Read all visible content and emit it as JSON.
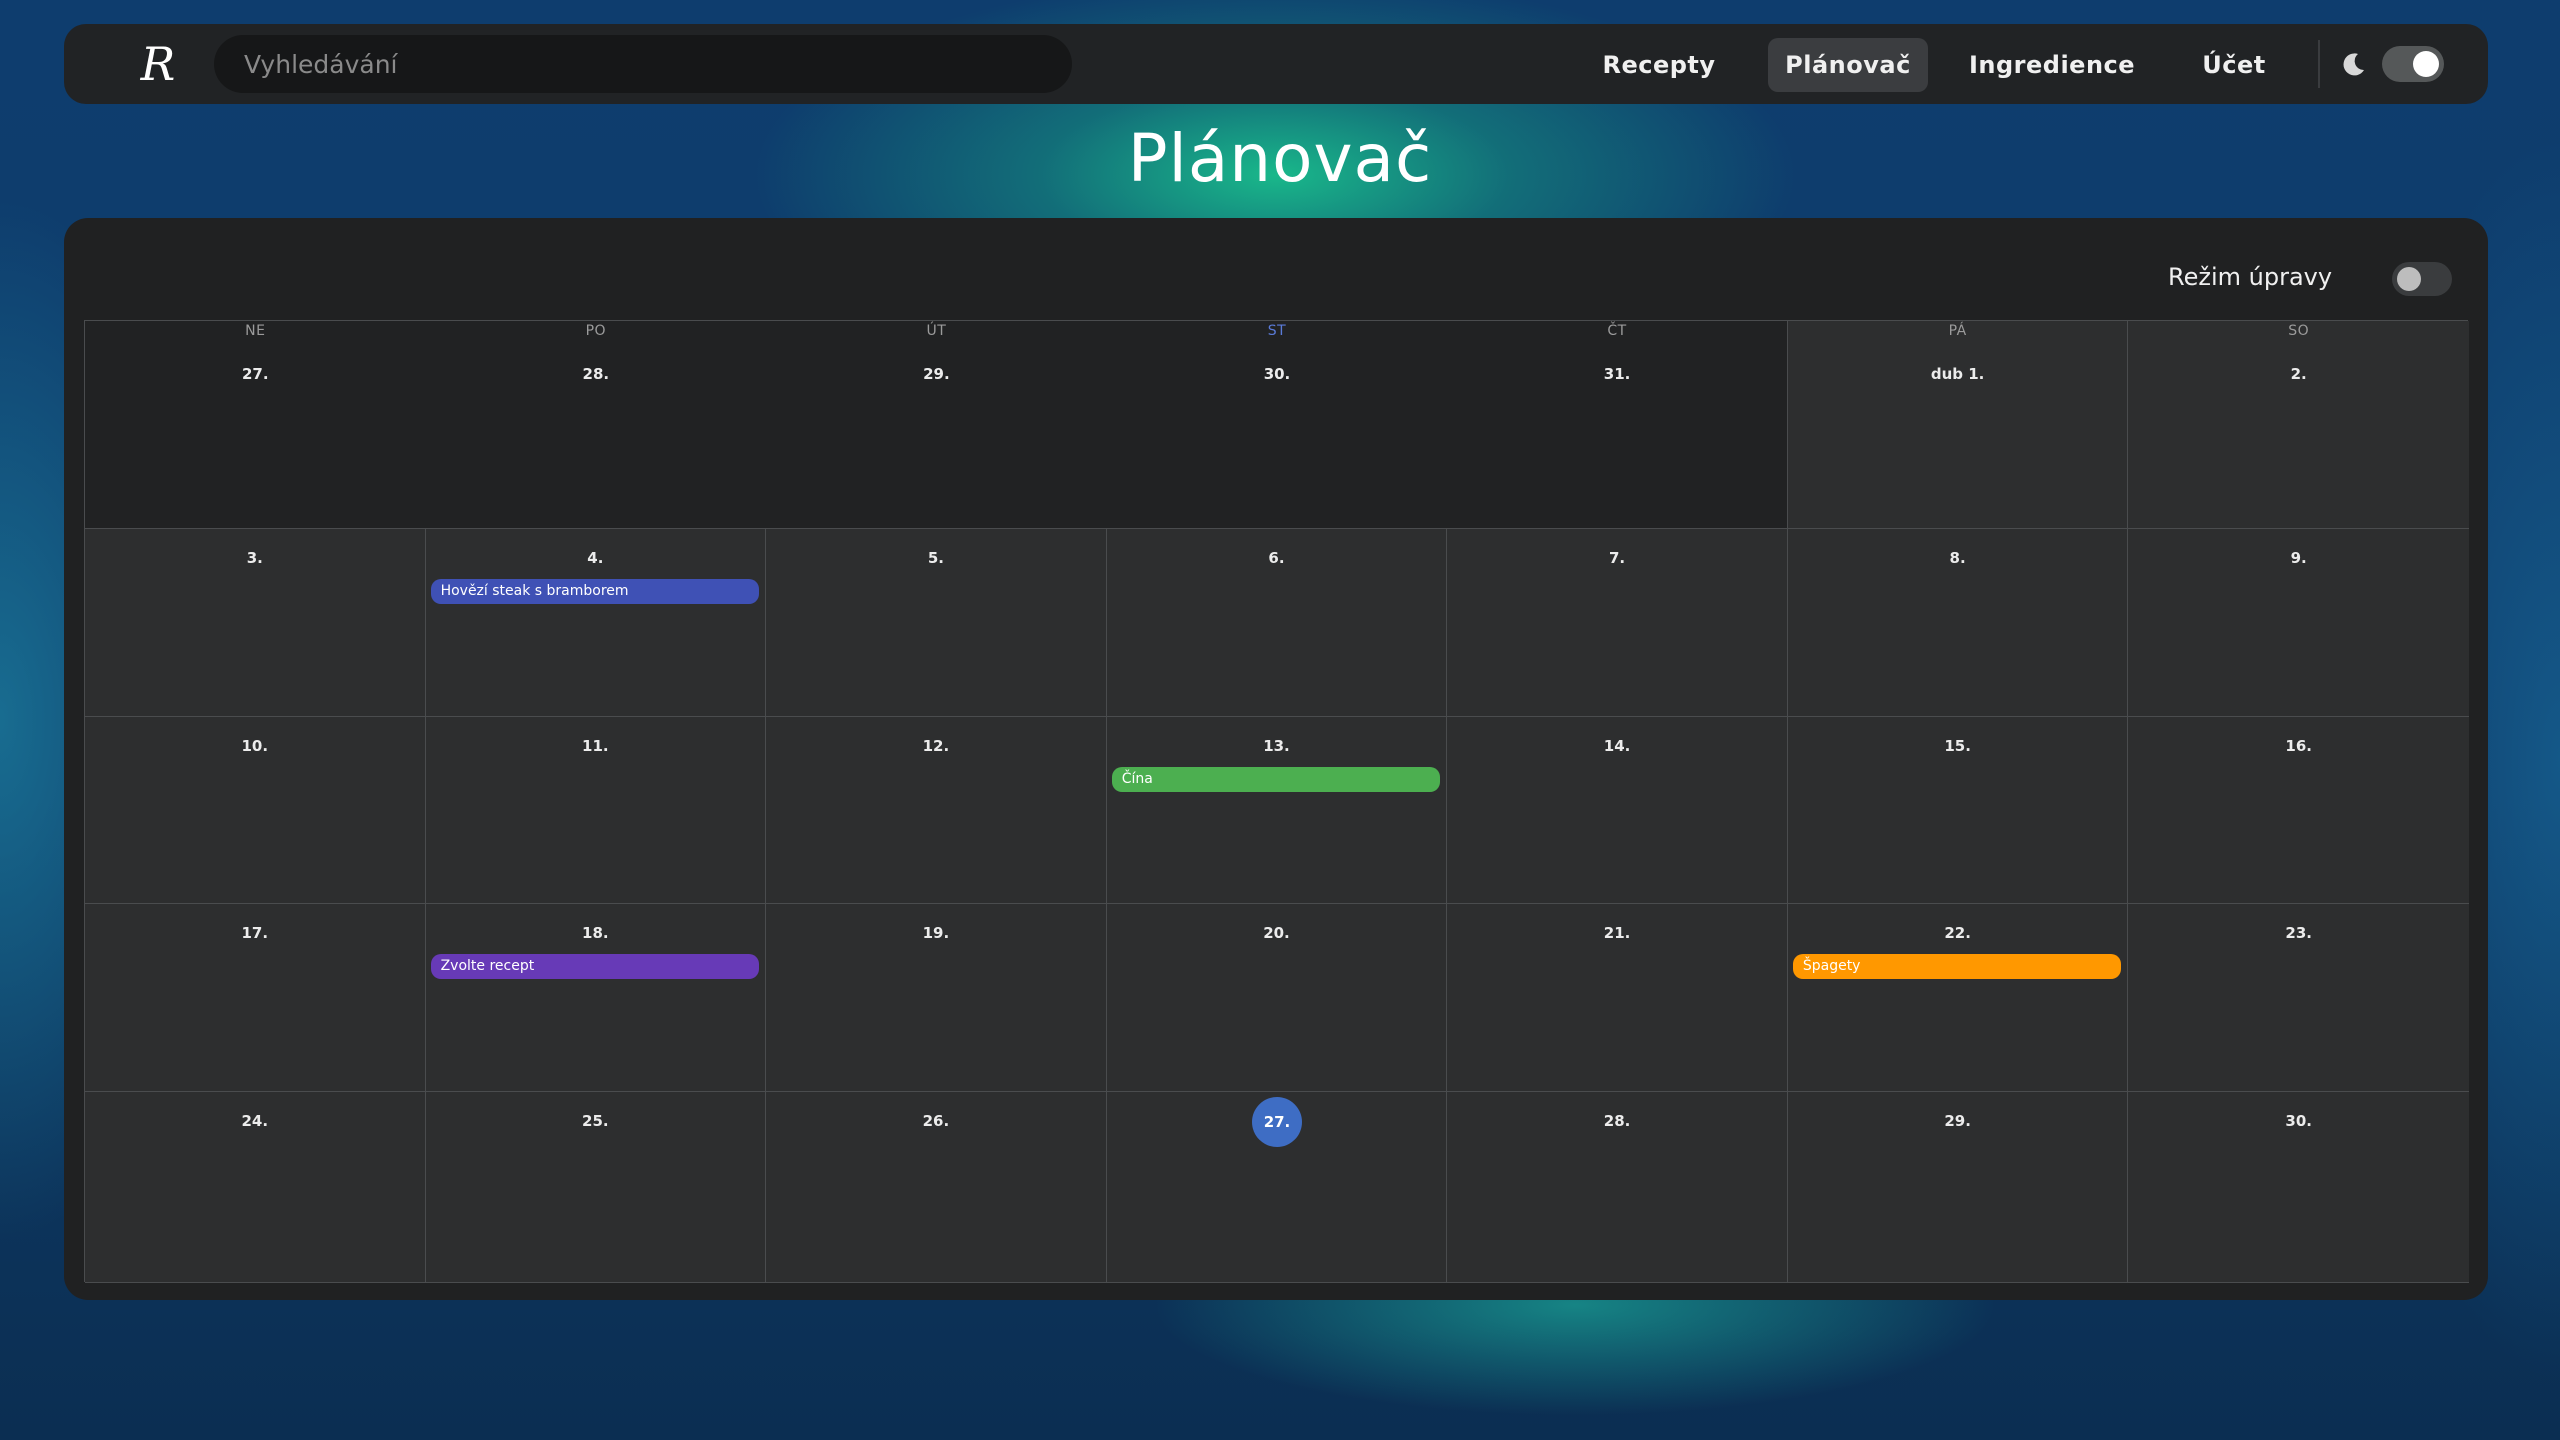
{
  "nav": {
    "logo": "R",
    "search_placeholder": "Vyhledávání",
    "links": [
      "Recepty",
      "Plánovač",
      "Ingredience",
      "Účet"
    ],
    "active_link": "Plánovač",
    "dark_mode_on": true
  },
  "page": {
    "title": "Plánovač"
  },
  "edit_mode": {
    "label": "Režim úpravy",
    "on": false
  },
  "calendar": {
    "weekday_headers": [
      "NE",
      "PO",
      "ÚT",
      "ST",
      "ČT",
      "PÁ",
      "SO"
    ],
    "highlighted_weekday": "ST",
    "weeks": [
      [
        "27.",
        "28.",
        "29.",
        "30.",
        "31.",
        "dub 1.",
        "2."
      ],
      [
        "3.",
        "4.",
        "5.",
        "6.",
        "7.",
        "8.",
        "9."
      ],
      [
        "10.",
        "11.",
        "12.",
        "13.",
        "14.",
        "15.",
        "16."
      ],
      [
        "17.",
        "18.",
        "19.",
        "20.",
        "21.",
        "22.",
        "23."
      ],
      [
        "24.",
        "25.",
        "26.",
        "27.",
        "28.",
        "29.",
        "30."
      ]
    ],
    "today": "27.",
    "events": [
      {
        "label": "Hovězí steak s bramborem",
        "date": "4.",
        "color": "#3f51b5"
      },
      {
        "label": "Čína",
        "date": "13.",
        "color": "#4caf50"
      },
      {
        "label": "Zvolte recept",
        "date": "18.",
        "color": "#673ab7"
      },
      {
        "label": "Špagety",
        "date": "22.",
        "color": "#ff9800"
      }
    ],
    "colors": {
      "today_circle": "#3e6dc4",
      "highlighted_header": "#5a7bd8"
    }
  }
}
